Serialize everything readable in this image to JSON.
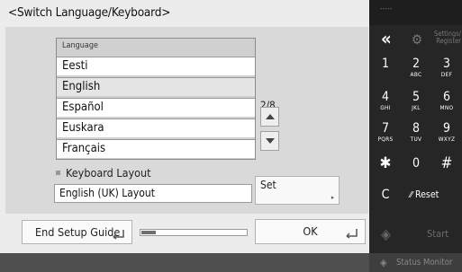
{
  "title": "<Switch Language/Keyboard>",
  "language_list": {
    "header": "Language",
    "items": [
      "Eesti",
      "English",
      "Español",
      "Euskara",
      "Français"
    ],
    "selected": "English",
    "page_indicator": "2/8"
  },
  "keyboard": {
    "label": "Keyboard Layout",
    "value": "English (UK) Layout",
    "set_label": "Set"
  },
  "footer": {
    "end_setup_label": "End Setup Guide",
    "progress_fraction": 0.14,
    "ok_label": "OK"
  },
  "keypad": {
    "top_label": "-----",
    "back_label": "«",
    "settings_label": "Settings/ Register",
    "keys": [
      {
        "digit": "1",
        "letters": ""
      },
      {
        "digit": "2",
        "letters": "ABC"
      },
      {
        "digit": "3",
        "letters": "DEF"
      },
      {
        "digit": "4",
        "letters": "GHI"
      },
      {
        "digit": "5",
        "letters": "JKL"
      },
      {
        "digit": "6",
        "letters": "MNO"
      },
      {
        "digit": "7",
        "letters": "PQRS"
      },
      {
        "digit": "8",
        "letters": "TUV"
      },
      {
        "digit": "9",
        "letters": "WXYZ"
      },
      {
        "digit": "✱",
        "letters": ""
      },
      {
        "digit": "0",
        "letters": ""
      },
      {
        "digit": "#",
        "letters": ""
      }
    ],
    "clear_label": "C",
    "reset_label": "Reset",
    "start_label": "Start",
    "status_monitor_label": "Status Monitor"
  },
  "colors": {
    "keypad_bg": "#262626",
    "screen_bg": "#ececec",
    "panel_bg": "#d9d9d9",
    "accent_disabled": "#6c6c6c"
  },
  "icons": [
    "back-icon",
    "gear-icon",
    "return-icon",
    "chevron-up-icon",
    "chevron-down-icon",
    "diamond-start-icon",
    "status-monitor-icon"
  ]
}
